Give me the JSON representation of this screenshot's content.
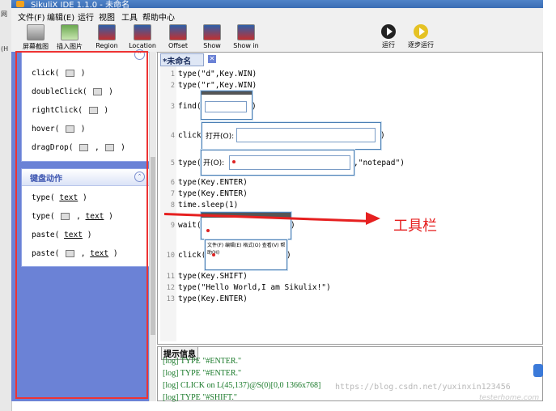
{
  "window": {
    "title": "SikuliX IDE 1.1.0 - 未命名"
  },
  "sliver": {
    "line1": "网",
    "line2": "(H"
  },
  "menu": {
    "file": "文件(F)",
    "edit": "编辑(E)",
    "run": "运行",
    "view": "视图",
    "tools": "工具",
    "help": "帮助中心"
  },
  "toolbar": {
    "capture": "屏幕截图",
    "insert_image": "插入图片",
    "region": "Region",
    "location": "Location",
    "offset": "Offset",
    "show": "Show",
    "show_in": "Show in",
    "run": "运行",
    "run_slow": "逐步运行"
  },
  "mouse_section": {
    "click": "click(",
    "doubleclick": "doubleClick(",
    "rightclick": "rightClick(",
    "hover": "hover(",
    "dragdrop": "dragDrop(",
    "close_paren": ")"
  },
  "keyboard_section": {
    "header": "键盘动作",
    "type1": "type(",
    "type2": "type(",
    "paste1": "paste(",
    "paste2": "paste(",
    "text_param": "text",
    "close_paren": ")"
  },
  "editor": {
    "tab_label": "*未命名",
    "tab_close": "✕",
    "line_numbers": [
      "1",
      "2",
      "3",
      "4",
      "5",
      "6",
      "7",
      "8",
      "9",
      "10",
      "11",
      "12",
      "13"
    ],
    "lines": {
      "l1": "type(\"d\",Key.WIN)",
      "l2": "type(\"r\",Key.WIN)",
      "l3a": "find(",
      "l3b": ")",
      "l4a": "click(",
      "l4b": ")",
      "l4_dialog_label": "打开(O):",
      "l5a": "type(",
      "l5b": ",\"notepad\")",
      "l5_dialog_label": "开(O):",
      "l6": "type(Key.ENTER)",
      "l7": "type(Key.ENTER)",
      "l8": "time.sleep(1)",
      "l9a": "wait(",
      "l9b": ")",
      "l10a": "click(",
      "l10b": ")",
      "l10_thumb_text": "文件(F) 编辑(E) 格式(O) 查看(V) 帮助(H)",
      "l11": "type(Key.SHIFT)",
      "l12": "type(\"Hello World,I am Sikulix!\")",
      "l13": "type(Key.ENTER)"
    }
  },
  "annotation": {
    "label": "工具栏"
  },
  "messages": {
    "tab": "提示信息",
    "lines": [
      "[log] TYPE \"#ENTER.\"",
      "[log] TYPE \"#ENTER.\"",
      "[log] CLICK on L(45,137)@S(0)[0,0 1366x768]",
      "[log] TYPE \"#SHIFT.\""
    ]
  },
  "watermark": {
    "url": "https://blog.csdn.net/yuxinxin123456",
    "site": "testerhome.com"
  },
  "colors": {
    "panel_blue": "#6b82d6",
    "annotation_red": "#e62020",
    "log_green": "#1a7a2a"
  },
  "icons": [
    "camera-icon",
    "image-icon",
    "region-icon",
    "location-icon",
    "offset-icon",
    "show-icon",
    "show-in-icon",
    "run-icon",
    "run-slow-icon",
    "collapse-icon",
    "close-icon"
  ]
}
